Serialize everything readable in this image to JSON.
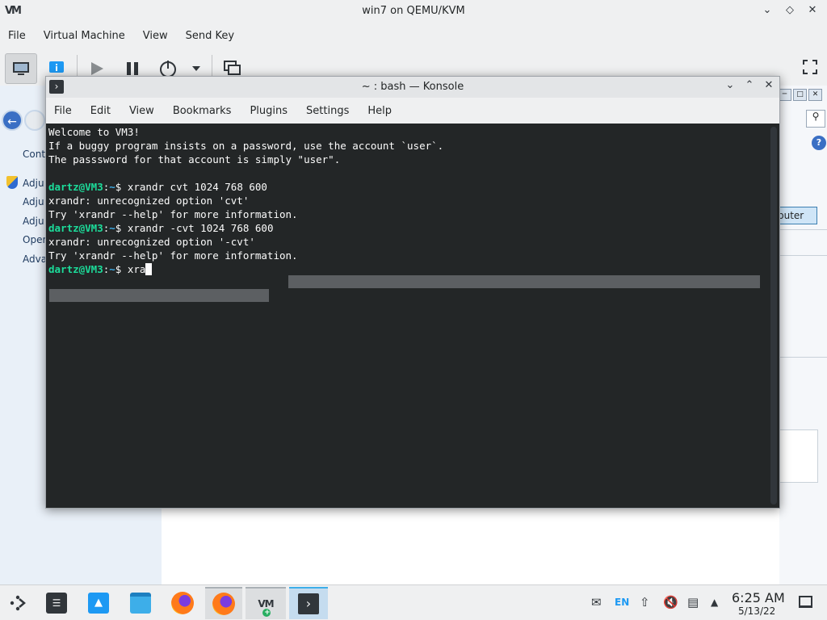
{
  "vm_window": {
    "title": "win7 on QEMU/KVM",
    "logo": "VM",
    "menu": [
      "File",
      "Virtual Machine",
      "View",
      "Send Key"
    ],
    "toolbar": {
      "console_icon": "monitor-icon",
      "details_icon": "info-icon",
      "run_icon": "play-icon",
      "pause_icon": "pause-icon",
      "power_icon": "power-icon",
      "power_menu_icon": "chevron-down-icon",
      "snapshot_icon": "snapshot-icon",
      "fullscreen_icon": "fullscreen-icon"
    }
  },
  "guest": {
    "links": [
      "Cont",
      "Adju",
      "Adju",
      "Adju",
      "Oper",
      "Adva"
    ],
    "computer_button": "puter"
  },
  "konsole": {
    "title": "~ : bash — Konsole",
    "menu": [
      "File",
      "Edit",
      "View",
      "Bookmarks",
      "Plugins",
      "Settings",
      "Help"
    ],
    "lines": [
      {
        "type": "text",
        "text": "Welcome to VM3!"
      },
      {
        "type": "text",
        "text": "If a buggy program insists on a password, use the account `user`."
      },
      {
        "type": "text",
        "text": "The passsword for that account is simply \"user\"."
      },
      {
        "type": "text",
        "text": ""
      },
      {
        "type": "prompt",
        "user": "dartz@VM3",
        "path": "~",
        "cmd": "xrandr cvt 1024 768 600"
      },
      {
        "type": "text",
        "text": "xrandr: unrecognized option 'cvt'"
      },
      {
        "type": "text",
        "text": "Try 'xrandr --help' for more information."
      },
      {
        "type": "prompt",
        "user": "dartz@VM3",
        "path": "~",
        "cmd": "xrandr -cvt 1024 768 600"
      },
      {
        "type": "text",
        "text": "xrandr: unrecognized option '-cvt'"
      },
      {
        "type": "text",
        "text": "Try 'xrandr --help' for more information."
      },
      {
        "type": "prompt_current",
        "user": "dartz@VM3",
        "path": "~",
        "cmd": "xra"
      }
    ],
    "colors": {
      "background": "#232627",
      "user": "#1cdc9a",
      "path": "#3daee9",
      "text": "#fcfcfc"
    }
  },
  "taskbar": {
    "apps": [
      {
        "name": "application-launcher",
        "icon": "launcher-icon"
      },
      {
        "name": "system-settings",
        "icon": "settings-icon"
      },
      {
        "name": "discover",
        "icon": "store-icon"
      },
      {
        "name": "dolphin",
        "icon": "folder-icon"
      },
      {
        "name": "firefox",
        "icon": "firefox-icon"
      },
      {
        "name": "firefox-running",
        "icon": "firefox-icon"
      },
      {
        "name": "virt-manager",
        "icon": "virt-manager-icon"
      },
      {
        "name": "konsole",
        "icon": "terminal-icon"
      }
    ],
    "tray": {
      "language": "EN",
      "time": "6:25 AM",
      "date": "5/13/22"
    }
  }
}
